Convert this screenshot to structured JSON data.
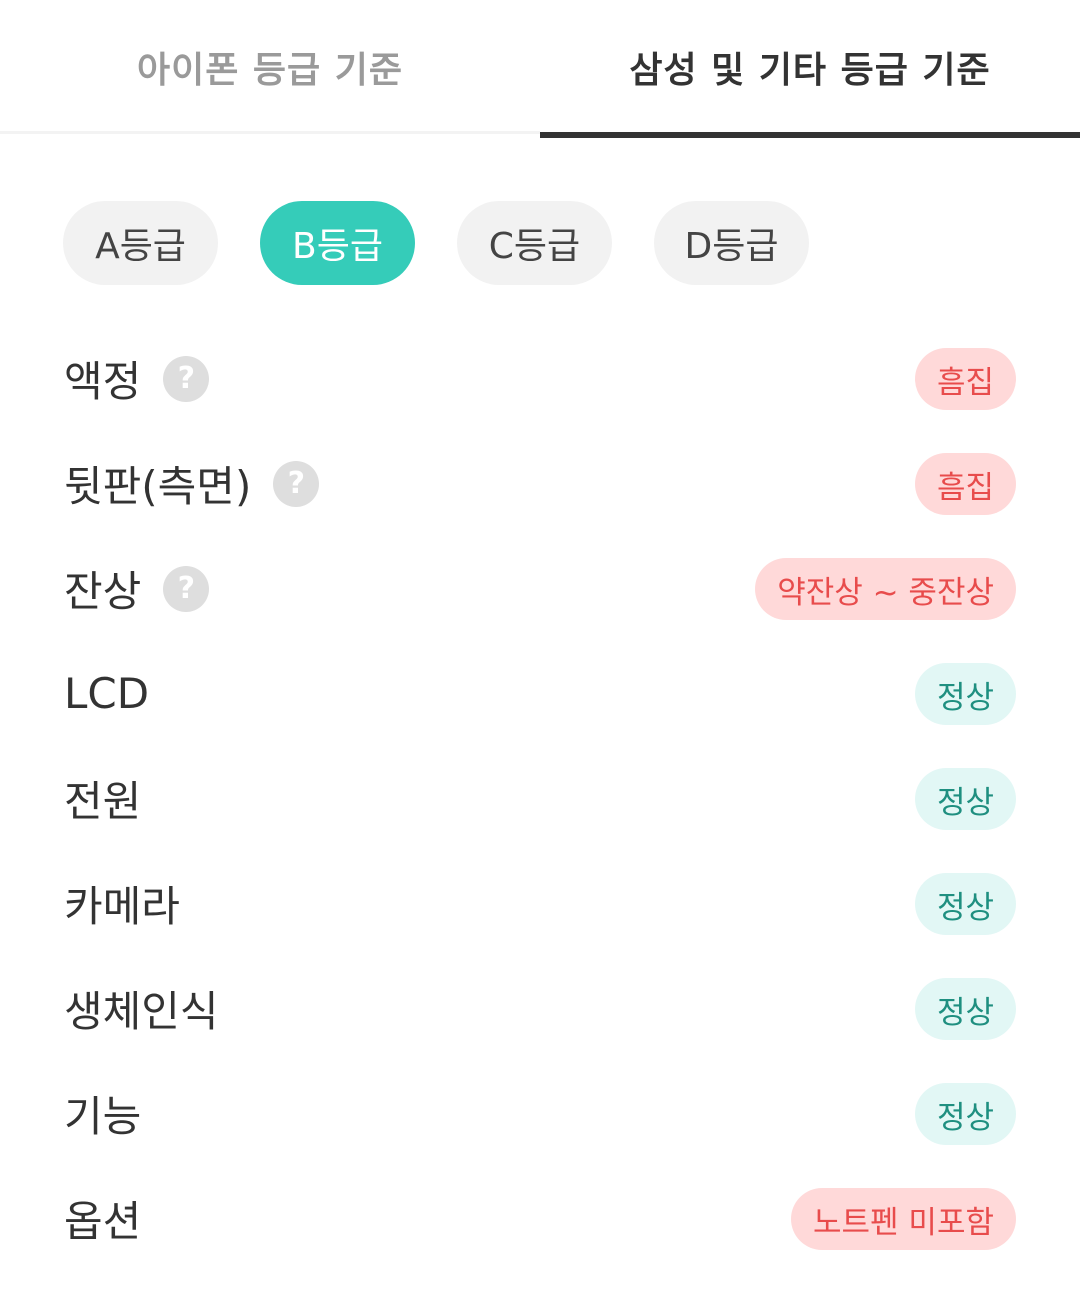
{
  "tabs": [
    {
      "label": "아이폰 등급 기준",
      "active": false
    },
    {
      "label": "삼성 및 기타 등급 기준",
      "active": true
    }
  ],
  "grades": [
    {
      "label": "A등급",
      "selected": false
    },
    {
      "label": "B등급",
      "selected": true
    },
    {
      "label": "C등급",
      "selected": false
    },
    {
      "label": "D등급",
      "selected": false
    }
  ],
  "help_icon_glyph": "?",
  "colors": {
    "accent": "#35ccb9",
    "bad_bg": "#ffd9d9",
    "bad_text": "#e84c4c",
    "good_bg": "#e2f7f5",
    "good_text": "#1f8f80"
  },
  "criteria": [
    {
      "label": "액정",
      "has_help": true,
      "value": "흠집",
      "status": "bad"
    },
    {
      "label": "뒷판(측면)",
      "has_help": true,
      "value": "흠집",
      "status": "bad"
    },
    {
      "label": "잔상",
      "has_help": true,
      "value": "약잔상 ~ 중잔상",
      "status": "bad"
    },
    {
      "label": "LCD",
      "has_help": false,
      "value": "정상",
      "status": "good"
    },
    {
      "label": "전원",
      "has_help": false,
      "value": "정상",
      "status": "good"
    },
    {
      "label": "카메라",
      "has_help": false,
      "value": "정상",
      "status": "good"
    },
    {
      "label": "생체인식",
      "has_help": false,
      "value": "정상",
      "status": "good"
    },
    {
      "label": "기능",
      "has_help": false,
      "value": "정상",
      "status": "good"
    },
    {
      "label": "옵션",
      "has_help": false,
      "value": "노트펜 미포함",
      "status": "bad"
    }
  ]
}
